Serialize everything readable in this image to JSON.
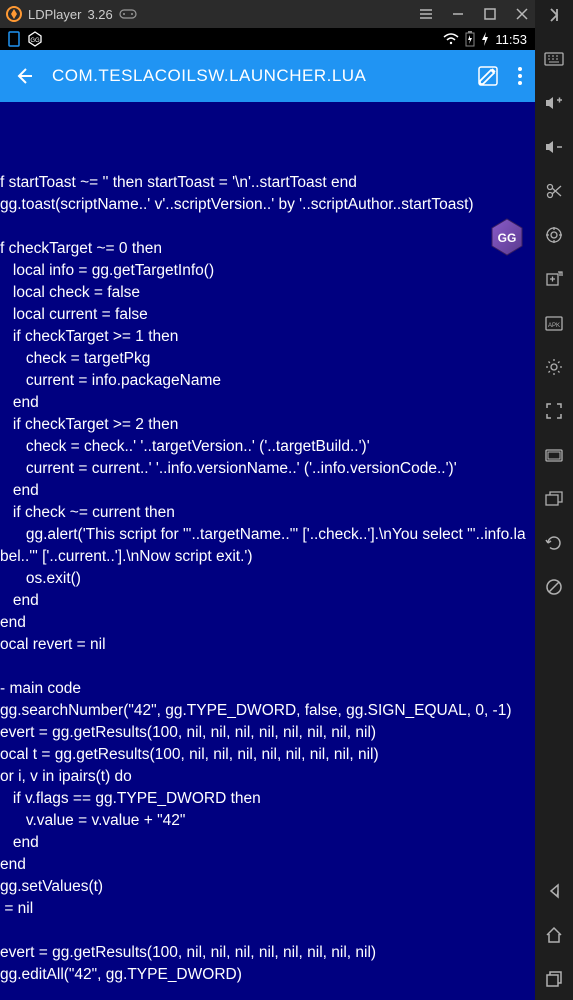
{
  "titlebar": {
    "app_name": "LDPlayer",
    "version": "3.26"
  },
  "statusbar": {
    "time": "11:53"
  },
  "toolbar": {
    "title": "COM.TESLACOILSW.LAUNCHER.LUA"
  },
  "content": {
    "code": "\nf startToast ~= '' then startToast = '\\n'..startToast end\ngg.toast(scriptName..' v'..scriptVersion..' by '..scriptAuthor..startToast)\n\nf checkTarget ~= 0 then\n   local info = gg.getTargetInfo()\n   local check = false\n   local current = false\n   if checkTarget >= 1 then\n      check = targetPkg\n      current = info.packageName\n   end\n   if checkTarget >= 2 then\n      check = check..' '..targetVersion..' ('..targetBuild..')'\n      current = current..' '..info.versionName..' ('..info.versionCode..')'\n   end\n   if check ~= current then\n      gg.alert('This script for \"'..targetName..'\" ['..check..'].\\nYou select \"'..info.label..'\" ['..current..'].\\nNow script exit.')\n      os.exit()\n   end\nend\nocal revert = nil\n\n- main code\ngg.searchNumber(\"42\", gg.TYPE_DWORD, false, gg.SIGN_EQUAL, 0, -1)\nevert = gg.getResults(100, nil, nil, nil, nil, nil, nil, nil, nil)\nocal t = gg.getResults(100, nil, nil, nil, nil, nil, nil, nil, nil)\nor i, v in ipairs(t) do\n   if v.flags == gg.TYPE_DWORD then\n      v.value = v.value + \"42\"\n   end\nend\ngg.setValues(t)\n = nil\n\nevert = gg.getResults(100, nil, nil, nil, nil, nil, nil, nil, nil)\ngg.editAll(\"42\", gg.TYPE_DWORD)"
  },
  "sidebar_icons": {
    "collapse": "collapse",
    "keyboard": "keyboard",
    "volumeup": "volume-up",
    "volumedown": "volume-down",
    "scissors": "scissors",
    "location": "location",
    "addscreen": "add-screen",
    "apk": "apk",
    "settings": "settings",
    "fullscreen": "fullscreen",
    "screenshot": "screenshot",
    "copy": "copy",
    "rotate": "rotate",
    "norotate": "no-rotate",
    "back": "back",
    "home": "home",
    "recent": "recent"
  }
}
